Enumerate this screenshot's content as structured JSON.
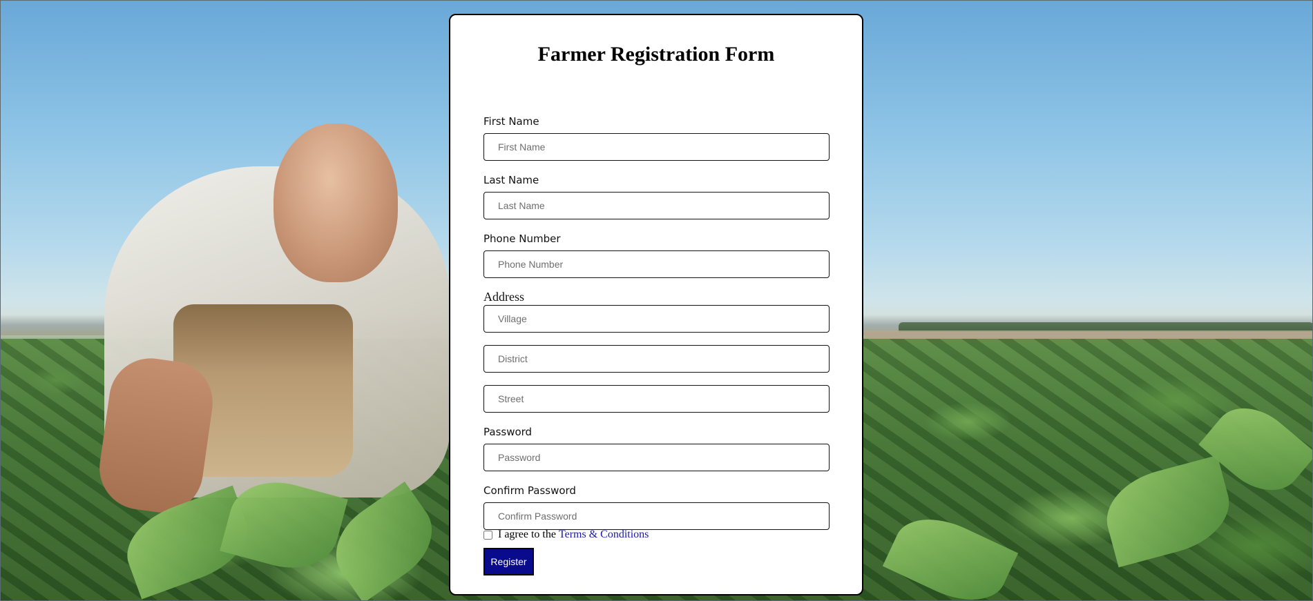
{
  "background": {
    "scene": "farmer-in-soybean-field",
    "colors": {
      "sky": "#8ec4e6",
      "field": "#3d6b32"
    }
  },
  "form": {
    "title": "Farmer Registration Form",
    "fields": {
      "first_name": {
        "label": "First Name",
        "placeholder": "First Name",
        "value": ""
      },
      "last_name": {
        "label": "Last Name",
        "placeholder": "Last Name",
        "value": ""
      },
      "phone": {
        "label": "Phone Number",
        "placeholder": "Phone Number",
        "value": ""
      },
      "address": {
        "label": "Address",
        "village_placeholder": "Village",
        "district_placeholder": "District",
        "street_placeholder": "Street"
      },
      "password": {
        "label": "Password",
        "placeholder": "Password",
        "value": ""
      },
      "confirm_password": {
        "label": "Confirm Password",
        "placeholder": "Confirm Password",
        "value": ""
      }
    },
    "terms": {
      "checked": false,
      "prefix": "I agree to the",
      "link_text": "Terms & Conditions",
      "link_color": "#1a1aa6"
    },
    "register_label": "Register",
    "accent_color": "#0a0a8c"
  }
}
